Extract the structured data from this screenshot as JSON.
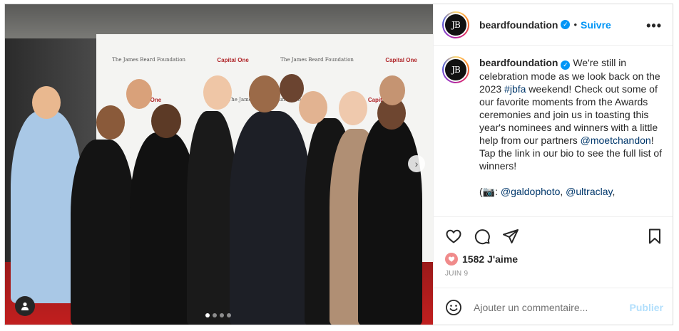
{
  "post": {
    "username": "beardfoundation",
    "avatar_text": "JB",
    "separator": "•",
    "follow_label": "Suivre",
    "more_label": "•••",
    "caption": {
      "line1_pre": " We're still in celebration mode as we look back on the 2023 ",
      "hashtag": "#jbfa",
      "line1_mid": " weekend! Check out some of our favorite moments from the Awards ceremonies and join us in toasting this year's nominees and winners with a little help from our partners ",
      "mention_partner": "@moetchandon",
      "line1_post": "! Tap the link in our bio to see the full list of winners!",
      "credits_pre": "(📷: ",
      "credit1": "@galdophoto",
      "credits_sep": ", ",
      "credit2": "@ultraclay",
      "credits_post": ","
    },
    "likes": "1582 J'aime",
    "date": "JUIN 9",
    "comment_placeholder": "Ajouter un commentaire...",
    "publish_label": "Publier",
    "media": {
      "next_arrow": "›",
      "slides": 4,
      "active_slide": 0,
      "backdrop_logos": [
        "The James Beard Foundation",
        "Capital One"
      ]
    },
    "colors": {
      "accent": "#0095f6",
      "link": "#00376b",
      "like_badge": "#f08b8b",
      "publish_disabled": "#b2dffc"
    }
  }
}
